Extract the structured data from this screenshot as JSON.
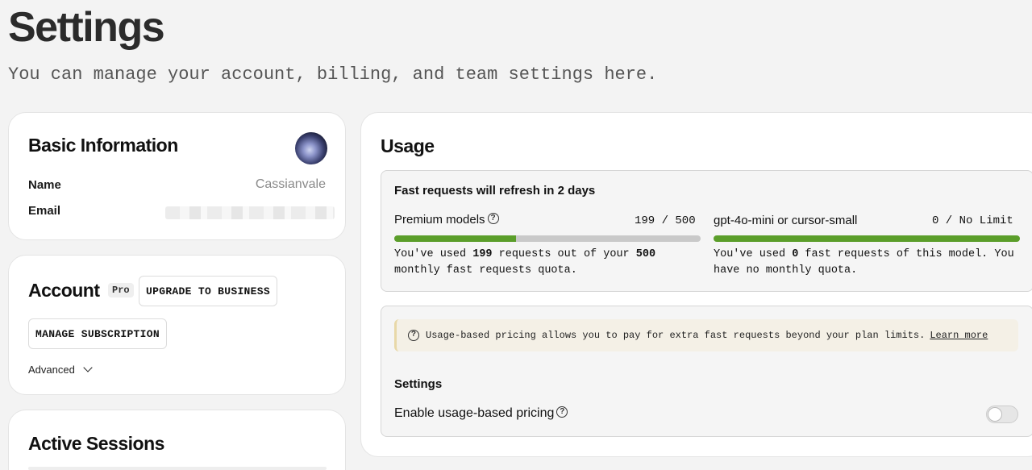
{
  "page": {
    "title": "Settings",
    "subtitle": "You can manage your account, billing, and team settings here."
  },
  "basic_info": {
    "heading": "Basic Information",
    "name_label": "Name",
    "name_value": "Cassianvale",
    "email_label": "Email"
  },
  "account": {
    "heading": "Account",
    "plan_badge": "Pro",
    "upgrade_button": "UPGRADE TO BUSINESS",
    "manage_button": "MANAGE SUBSCRIPTION",
    "advanced_label": "Advanced"
  },
  "sessions": {
    "heading": "Active Sessions"
  },
  "usage": {
    "heading": "Usage",
    "refresh_text": "Fast requests will refresh in 2 days",
    "premium": {
      "name": "Premium models",
      "count": "199 / 500",
      "used": 199,
      "limit": 500,
      "desc_prefix": "You've used ",
      "desc_used": "199",
      "desc_mid": " requests out of your ",
      "desc_limit": "500",
      "desc_suffix": " monthly fast requests quota."
    },
    "mini": {
      "name": "gpt-4o-mini or cursor-small",
      "count": "0 / No Limit",
      "fill_fraction": 1.0,
      "desc_prefix": "You've used ",
      "desc_used": "0",
      "desc_suffix": " fast requests of this model. You have no monthly quota."
    },
    "notice_text": "Usage-based pricing allows you to pay for extra fast requests beyond your plan limits.",
    "learn_more": "Learn more",
    "settings_heading": "Settings",
    "enable_label": "Enable usage-based pricing",
    "enable_on": false
  },
  "colors": {
    "accent_green": "#5b9e2a",
    "notice_bg": "#f4f0e6"
  }
}
